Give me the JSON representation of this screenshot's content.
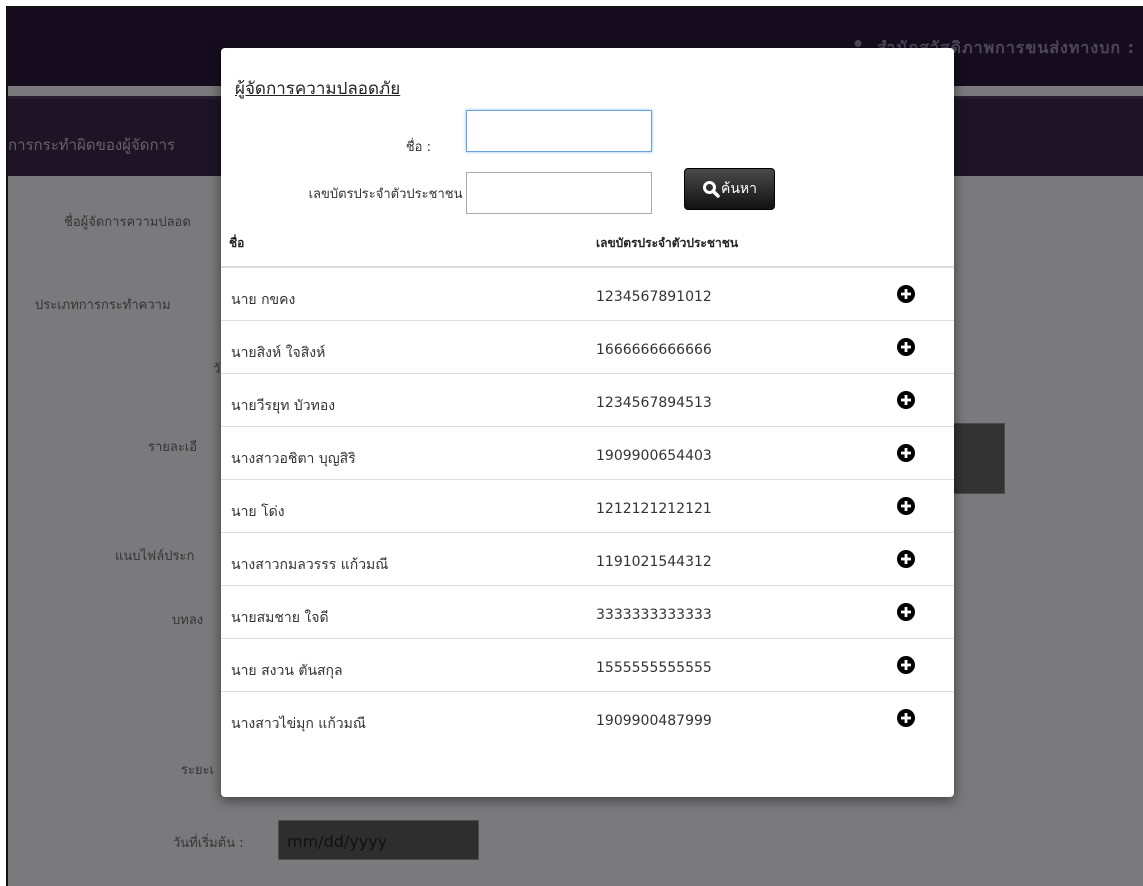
{
  "header": {
    "user_text": "สำนักสวัสดิภาพการขนส่งทางบก :"
  },
  "titlebar": {
    "title": "การกระทำผิดของผู้จัดการ"
  },
  "background_form": {
    "labels": [
      "ชื่อผู้จัดการความปลอด",
      "ประเภทการกระทำความ",
      "วั",
      "รายละเอี",
      "แนบไฟล์ประก",
      "บทลง",
      "ระยะเ",
      "วันที่เริ่มต้น :"
    ],
    "date_placeholder": "mm/dd/yyyy"
  },
  "modal": {
    "title": "ผู้จัดการความปลอดภัย",
    "name_label": "ชื่อ :",
    "name_value": "",
    "id_label": "เลขบัตรประจำตัวประชาชน :",
    "id_value": "",
    "search_label": "ค้นหา",
    "columns": {
      "name": "ชื่อ",
      "id": "เลขบัตรประจำตัวประชาชน"
    },
    "rows": [
      {
        "name": "นาย กขคง",
        "id": "1234567891012"
      },
      {
        "name": "นายสิงห์ ใจสิงห์",
        "id": "1666666666666"
      },
      {
        "name": "นายวีรยุท บัวทอง",
        "id": "1234567894513"
      },
      {
        "name": "นางสาวอชิตา บุญสิริ",
        "id": "1909900654403"
      },
      {
        "name": "นาย โด่ง",
        "id": "1212121212121"
      },
      {
        "name": "นางสาวกมลวรรร แก้วมณี",
        "id": "1191021544312"
      },
      {
        "name": "นายสมชาย ใจดี",
        "id": "3333333333333"
      },
      {
        "name": "นาย สงวน ตันสกุล",
        "id": "1555555555555"
      },
      {
        "name": "นางสาวไข่มุก แก้วมณี",
        "id": "1909900487999"
      }
    ]
  },
  "icons": {
    "user": "user-icon",
    "search": "search-icon",
    "add": "plus-circle-icon"
  },
  "colors": {
    "topbar": "#2a1a3d",
    "titlebar": "#3b2a4a",
    "button": "#111111"
  }
}
